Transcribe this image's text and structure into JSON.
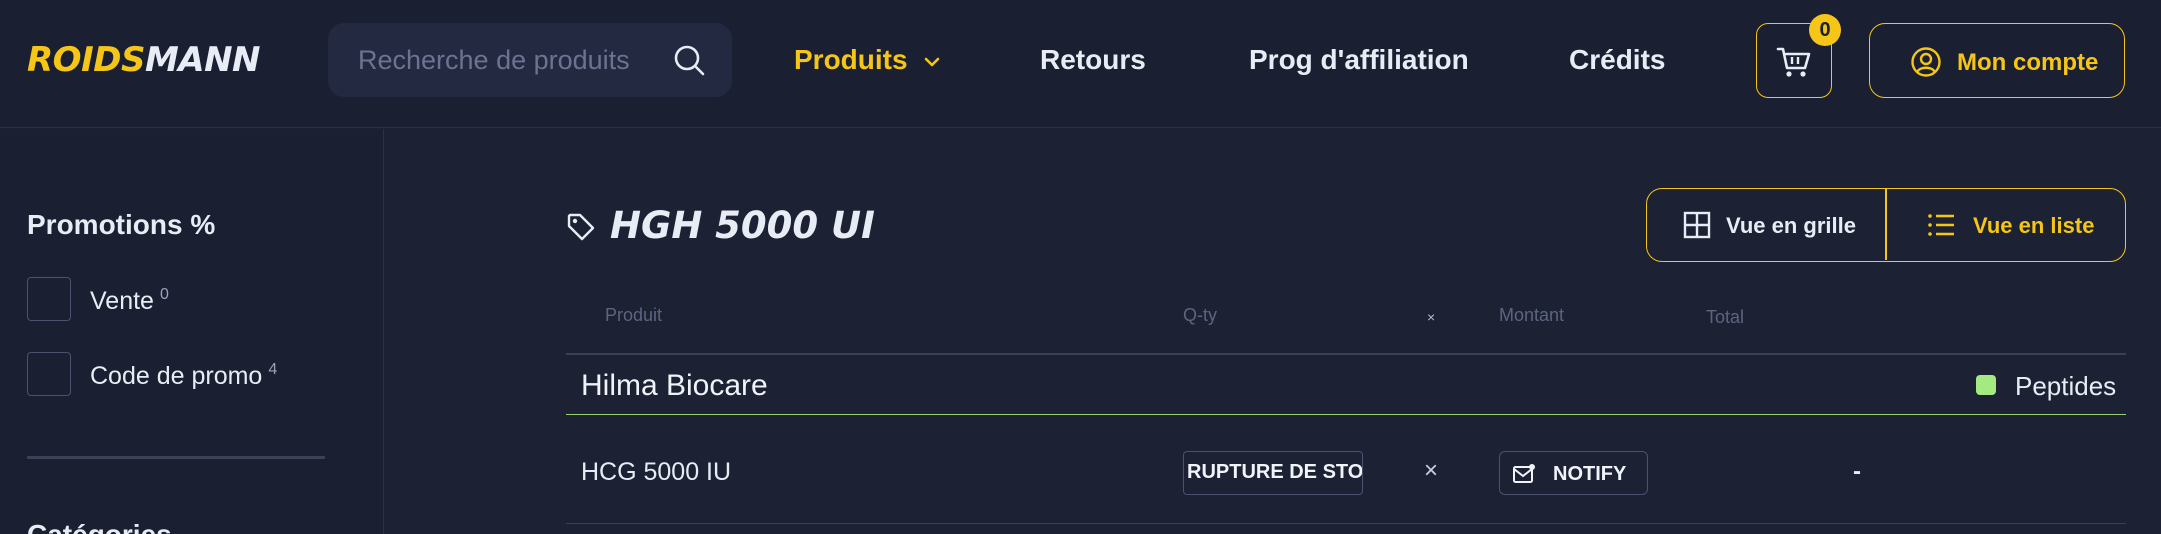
{
  "header": {
    "logo_part1": "ROIDS",
    "logo_part2": "MANN",
    "search": {
      "placeholder": "Recherche de produits",
      "value": ""
    },
    "nav": [
      {
        "label": "Produits",
        "active": true
      },
      {
        "label": "Retours"
      },
      {
        "label": "Prog d'affiliation"
      },
      {
        "label": "Crédits"
      }
    ],
    "cart_count": "0",
    "account_label": "Mon compte"
  },
  "sidebar": {
    "promotions_title": "Promotions %",
    "filters": [
      {
        "label": "Vente",
        "count": "0",
        "checked": false
      },
      {
        "label": "Code de promo",
        "count": "4",
        "checked": false
      }
    ],
    "next_section_title": "Catégories"
  },
  "main": {
    "title": "HGH 5000 UI",
    "view_grid_label": "Vue en grille",
    "view_list_label": "Vue en liste",
    "active_view": "list",
    "columns": {
      "product": "Produit",
      "qty": "Q-ty",
      "times": "×",
      "amount": "Montant",
      "total": "Total"
    },
    "group": {
      "brand": "Hilma Biocare",
      "category": "Peptides"
    },
    "rows": [
      {
        "name": "HCG 5000 IU",
        "stock_status": "RUPTURE DE STOCK",
        "times": "×",
        "notify_label": "NOTIFY",
        "total": "-"
      }
    ]
  },
  "colors": {
    "background": "#1c2233",
    "accent": "#f5c518",
    "category_dot": "#a5ea80",
    "text": "#e8ecf5"
  },
  "icons": [
    "search-icon",
    "chevron-down-icon",
    "cart-icon",
    "user-icon",
    "tag-icon",
    "grid-icon",
    "list-icon",
    "notify-icon"
  ]
}
